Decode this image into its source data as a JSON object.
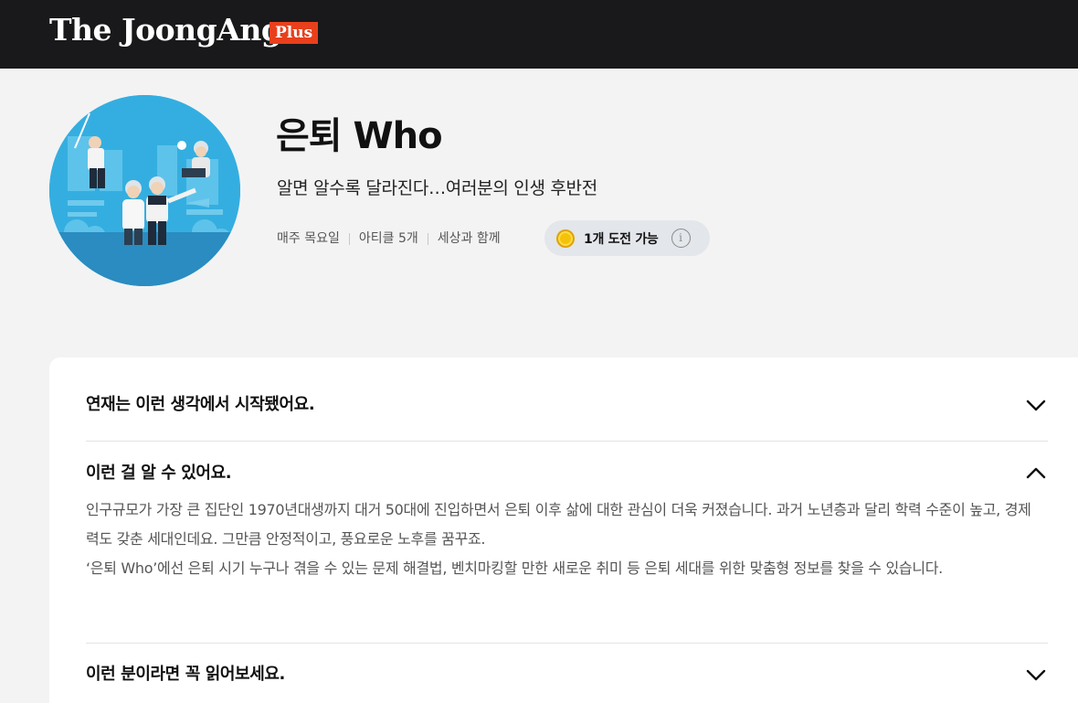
{
  "header": {
    "logo_text": "The JoongAng",
    "plus_badge": "Plus"
  },
  "series": {
    "title": "은퇴 Who",
    "subtitle": "알면 알수록 달라진다…여러분의 인생 후반전",
    "meta": [
      "매주 목요일",
      "아티클 5개",
      "세상과 함께"
    ],
    "challenge_label": "1개 도전 가능",
    "info_glyph": "i"
  },
  "accordion": [
    {
      "title": "연재는 이런 생각에서 시작됐어요.",
      "expanded": false
    },
    {
      "title": "이런 걸 알 수 있어요.",
      "expanded": true,
      "body": [
        "인구규모가 가장 큰 집단인 1970년대생까지 대거 50대에 진입하면서 은퇴 이후 삶에 대한 관심이 더욱 커졌습니다. 과거 노년층과 달리 학력 수준이 높고, 경제력도 갖춘 세대인데요. 그만큼 안정적이고, 풍요로운 노후를 꿈꾸죠.",
        "‘은퇴 Who’에선 은퇴 시기 누구나 겪을 수 있는 문제 해결법, 벤치마킹할 만한 새로운 취미 등 은퇴 세대를 위한 맞춤형 정보를 찾을 수 있습니다."
      ]
    },
    {
      "title": "이런 분이라면 꼭 읽어보세요.",
      "expanded": false
    }
  ],
  "colors": {
    "topbar": "#19181a",
    "plus_badge": "#e8401c",
    "avatar_bg": "#34aee0",
    "page_bg": "#f3f3f3",
    "card_bg": "#ffffff",
    "coin": "#f5c20a"
  },
  "icons": {
    "avatar": "retirees-illustration",
    "coin": "coin-icon",
    "info": "info-icon",
    "expand": "chevron-down-icon",
    "collapse": "chevron-up-icon"
  }
}
